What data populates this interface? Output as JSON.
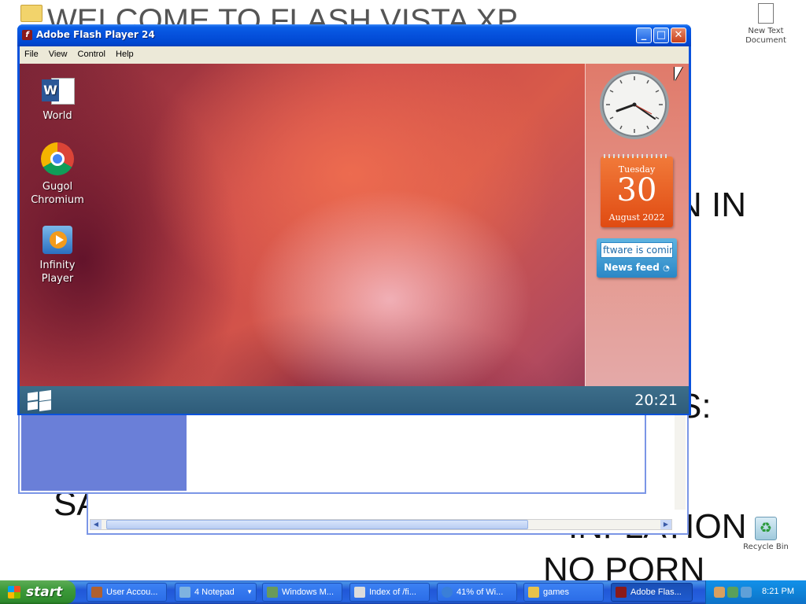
{
  "background_text": {
    "line1": "WELCOME TO FLASH VISTA XP",
    "line2": "N IN",
    "line3": "S:",
    "line4": "SA",
    "line5": "INFLATION",
    "line6": "NO  PORN"
  },
  "desktop": {
    "top_right_icon_label": "New Text Document",
    "recycle_bin_label": "Recycle Bin"
  },
  "flash_window": {
    "title": "Adobe Flash Player 24",
    "menu": [
      "File",
      "View",
      "Control",
      "Help"
    ],
    "content": {
      "icons": [
        {
          "label": "World",
          "icon": "word-icon"
        },
        {
          "label": "Gugol Chromium",
          "icon": "chromium-icon"
        },
        {
          "label": "Infinity Player",
          "icon": "media-player-icon"
        }
      ],
      "calendar": {
        "weekday": "Tuesday",
        "day": "30",
        "month_year": "August 2022"
      },
      "news": {
        "ticker": "ftware is comin",
        "label": "News feed"
      },
      "clock_time": "20:21"
    }
  },
  "taskbar": {
    "start_label": "start",
    "items": [
      {
        "label": "User Accou...",
        "icon": "users-icon",
        "color": "#b06030"
      },
      {
        "label": "4 Notepad",
        "icon": "notepad-icon",
        "color": "#7fb3e0"
      },
      {
        "label": "Windows M...",
        "icon": "windows-movie-icon",
        "color": "#6a9a5a"
      },
      {
        "label": "Index of /fi...",
        "icon": "document-icon",
        "color": "#dcdcdc"
      },
      {
        "label": "41% of Wi...",
        "icon": "ie-icon",
        "color": "#3a7fd8"
      },
      {
        "label": "games",
        "icon": "folder-icon",
        "color": "#e8c24a"
      },
      {
        "label": "Adobe Flas...",
        "icon": "flash-icon",
        "color": "#8a1a1a"
      }
    ],
    "clock": "8:21 PM"
  }
}
